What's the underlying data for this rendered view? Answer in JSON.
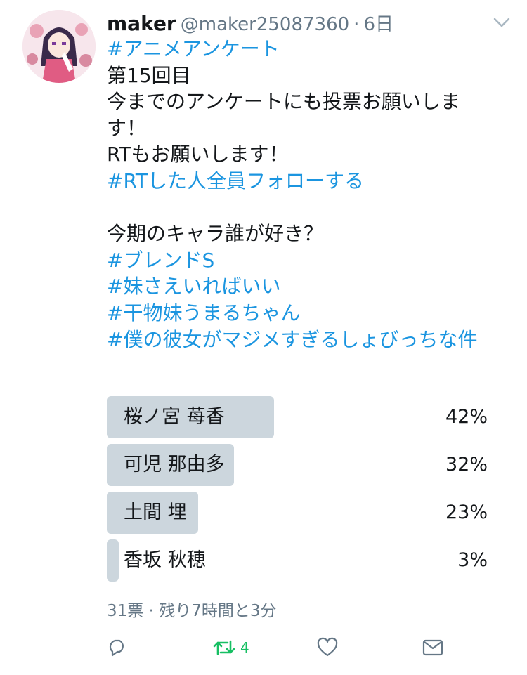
{
  "tweet": {
    "author_name": "maker",
    "author_handle": "@maker25087360",
    "separator": "·",
    "time": "6日",
    "lines": [
      {
        "text": "#アニメアンケート",
        "hashtag": true
      },
      {
        "text": "第15回目",
        "hashtag": false
      },
      {
        "text": "今までのアンケートにも投票お願いしま",
        "hashtag": false
      },
      {
        "text": "す！",
        "hashtag": false
      },
      {
        "text": "RTもお願いします！",
        "hashtag": false
      },
      {
        "text": "#RTした人全員フォローする",
        "hashtag": true
      },
      {
        "text": "",
        "hashtag": false
      },
      {
        "text": "今期のキャラ誰が好き？",
        "hashtag": false
      },
      {
        "text": "#ブレンドS",
        "hashtag": true
      },
      {
        "text": "#妹さえいればいい",
        "hashtag": true
      },
      {
        "text": "#干物妹うまるちゃん",
        "hashtag": true
      },
      {
        "text": "#僕の彼女がマジメすぎるしょびっちな件",
        "hashtag": true
      }
    ]
  },
  "poll": {
    "options": [
      {
        "label": "桜ノ宮 苺香",
        "percent_text": "42%",
        "percent": 42
      },
      {
        "label": "可児 那由多",
        "percent_text": "32%",
        "percent": 32
      },
      {
        "label": "土間 埋",
        "percent_text": "23%",
        "percent": 23
      },
      {
        "label": "香坂 秋穂",
        "percent_text": "3%",
        "percent": 3
      }
    ],
    "meta": "31票 · 残り7時間と3分"
  },
  "actions": {
    "reply_icon": "reply-icon",
    "retweet_icon": "retweet-icon",
    "retweet_count": "4",
    "like_icon": "heart-icon",
    "dm_icon": "envelope-icon"
  },
  "colors": {
    "hashtag": "#1b95e0",
    "secondary_text": "#657786",
    "poll_bar": "#ccd6dd",
    "retweet_active": "#17bf63"
  }
}
